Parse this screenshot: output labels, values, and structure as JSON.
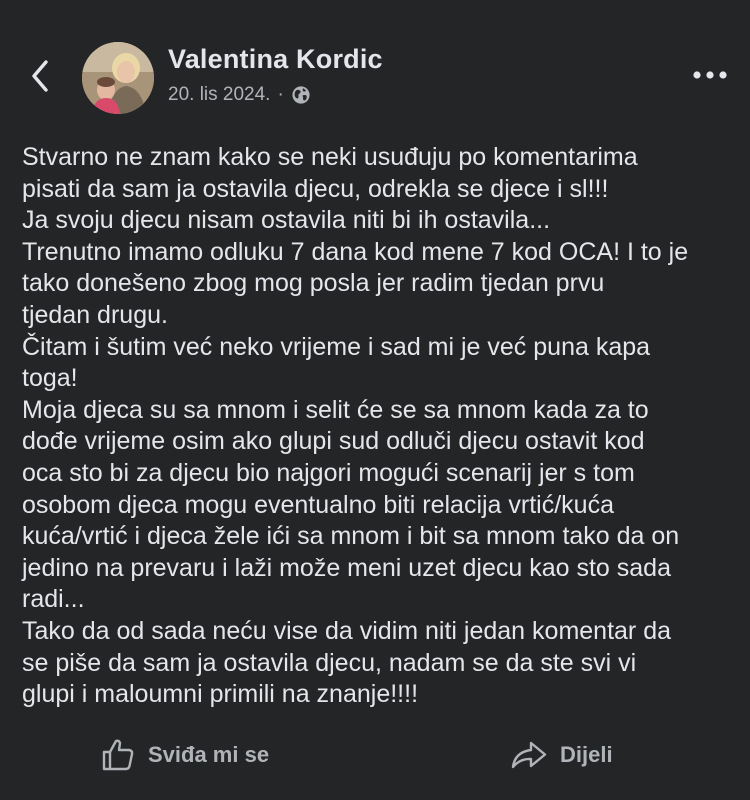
{
  "post": {
    "author": "Valentina Kordic",
    "date": "20. lis 2024.",
    "separator": "·",
    "privacy_icon": "globe-icon",
    "text": "Stvarno ne znam kako se neki usuđuju po komentarima\npisati da sam ja ostavila djecu, odrekla se djece i sl!!!\nJa svoju djecu nisam ostavila niti bi ih ostavila...\nTrenutno imamo odluku 7 dana kod mene 7 kod OCA! I to je\ntako donešeno zbog mog posla jer radim tjedan prvu\ntjedan drugu.\nČitam i šutim već neko vrijeme i sad mi je već puna kapa\ntoga!\nMoja djeca su sa mnom i selit će se sa mnom kada za to\ndođe vrijeme osim ako glupi sud odluči djecu ostavit kod\noca sto bi za djecu bio najgori mogući scenarij jer s tom\nosobom djeca mogu eventualno biti relacija vrtić/kuća\nkuća/vrtić i djeca žele ići sa mnom i bit sa mnom tako da on\njedino na prevaru i laži može meni uzet djecu kao sto sada\nradi...\nTako da od sada neću vise da vidim niti jedan komentar da\nse piše da sam ja ostavila djecu, nadam se da ste svi vi\nglupi i maloumni primili na znanje!!!!"
  },
  "actions": {
    "like_label": "Sviđa mi se",
    "share_label": "Dijeli"
  },
  "icons": {
    "back": "chevron-left-icon",
    "more": "more-horizontal-icon",
    "like": "thumbs-up-icon",
    "share": "share-icon"
  },
  "colors": {
    "background": "#242526",
    "primary_text": "#e4e6eb",
    "secondary_text": "#b0b3b8"
  }
}
